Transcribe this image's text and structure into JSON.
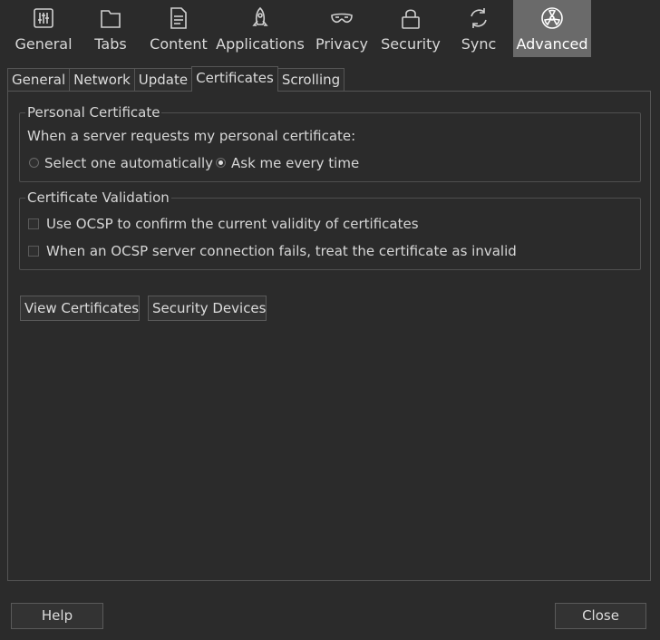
{
  "toolbar": {
    "items": [
      {
        "label": "General",
        "icon": "sliders-icon"
      },
      {
        "label": "Tabs",
        "icon": "tabs-icon"
      },
      {
        "label": "Content",
        "icon": "document-icon"
      },
      {
        "label": "Applications",
        "icon": "rocket-icon"
      },
      {
        "label": "Privacy",
        "icon": "mask-icon"
      },
      {
        "label": "Security",
        "icon": "lock-icon"
      },
      {
        "label": "Sync",
        "icon": "sync-icon"
      },
      {
        "label": "Advanced",
        "icon": "radiation-icon"
      }
    ],
    "active": "Advanced"
  },
  "subtabs": {
    "items": [
      "General",
      "Network",
      "Update",
      "Certificates",
      "Scrolling"
    ],
    "active": "Certificates"
  },
  "personal_certificate": {
    "title": "Personal Certificate",
    "prompt": "When a server requests my personal certificate:",
    "option_auto": "Select one automatically",
    "option_ask": "Ask me every time",
    "selected": "Ask me every time"
  },
  "certificate_validation": {
    "title": "Certificate Validation",
    "ocsp_confirm": "Use OCSP to confirm the current validity of certificates",
    "ocsp_fail": "When an OCSP server connection fails, treat the certificate as invalid"
  },
  "buttons": {
    "view_certificates": "View Certificates",
    "security_devices": "Security Devices",
    "help": "Help",
    "close": "Close"
  },
  "colors": {
    "background": "#2b2b2b",
    "active_toolbar": "#6a6a6a",
    "text": "#d6d6d6"
  }
}
